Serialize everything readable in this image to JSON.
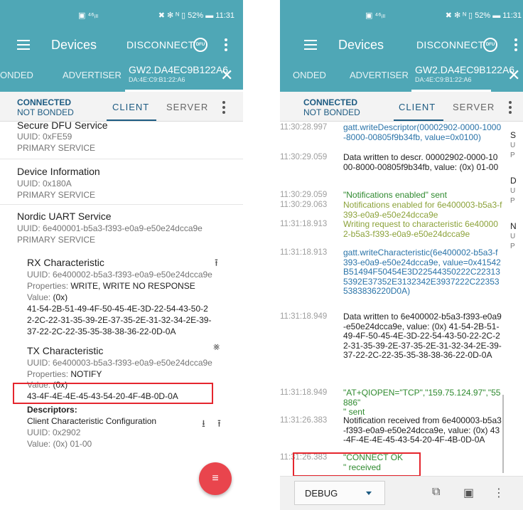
{
  "status": {
    "signal": "▣ ⁴⁶ᵢₗₗ",
    "indicators": "✖ ✻ ᴺ ▯ 52% ▬ 11:31",
    "right_indicators": "✖ ✻ ᴺ ▯ 52% ▬ 11:31"
  },
  "appbar": {
    "title": "Devices",
    "disconnect": "DISCONNECT",
    "dfu": "DFU"
  },
  "tabs": {
    "bonded": "ONDED",
    "advertiser": "ADVERTISER",
    "device_name": "GW2.DA4EC9B122A6",
    "device_addr": "DA:4E:C9:B1:22:A6",
    "close": "✕"
  },
  "conn": {
    "state": "CONNECTED",
    "bond": "NOT BONDED",
    "client": "CLIENT",
    "server": "SERVER"
  },
  "services": {
    "dfu": {
      "name": "Secure DFU Service",
      "uuid": "UUID: 0xFE59",
      "type": "PRIMARY SERVICE"
    },
    "devinfo": {
      "name": "Device Information",
      "uuid": "UUID: 0x180A",
      "type": "PRIMARY SERVICE"
    },
    "uart": {
      "name": "Nordic UART Service",
      "uuid": "UUID: 6e400001-b5a3-f393-e0a9-e50e24dcca9e",
      "type": "PRIMARY SERVICE"
    }
  },
  "rx": {
    "name": "RX Characteristic",
    "uuid": "UUID: 6e400002-b5a3-f393-e0a9-e50e24dcca9e",
    "props_label": "Properties: ",
    "props": "WRITE, WRITE NO RESPONSE",
    "value_label": "Value: ",
    "value_fmt": "(0x)",
    "value_l1": "41-54-2B-51-49-4F-50-45-4E-3D-22-54-43-50-2",
    "value_l2": "2-2C-22-31-35-39-2E-37-35-2E-31-32-34-2E-39-",
    "value_l3": "37-22-2C-22-35-35-38-38-36-22-0D-0A"
  },
  "tx": {
    "name": "TX Characteristic",
    "uuid": "UUID: 6e400003-b5a3-f393-e0a9-e50e24dcca9e",
    "props_label": "Properties: ",
    "props": "NOTIFY",
    "value_label": "Value: ",
    "value_fmt": "(0x)",
    "value_l1": "43-4F-4E-4E-45-43-54-20-4F-4B-0D-0A"
  },
  "descriptors": {
    "header": "Descriptors:",
    "name": "Client Characteristic Configuration",
    "uuid": "UUID: 0x2902",
    "value_label": "Value: ",
    "value": "(0x) 01-00"
  },
  "icons": {
    "upload": "⭱",
    "download": "⭳",
    "notify_off": "⨳",
    "fab": "≡"
  },
  "log": [
    {
      "ts": "11:30:28.997",
      "msg": "gatt.writeDescriptor(00002902-0000-1000-8000-00805f9b34fb, value=0x0100)",
      "color": "c-blue"
    },
    {
      "ts": "11:30:29.059",
      "msg": "Data written to descr. 00002902-0000-1000-8000-00805f9b34fb, value: (0x) 01-00",
      "color": "c-dark"
    },
    {
      "ts": "11:30:29.059",
      "msg": "\"Notifications enabled\" sent",
      "color": "c-green"
    },
    {
      "ts": "11:30:29.063",
      "msg": "Notifications enabled for 6e400003-b5a3-f393-e0a9-e50e24dcca9e",
      "color": "c-olive"
    },
    {
      "ts": "11:31:18.913",
      "msg": "Writing request to characteristic 6e400002-b5a3-f393-e0a9-e50e24dcca9e",
      "color": "c-olive"
    },
    {
      "ts": "11:31:18.913",
      "msg": "gatt.writeCharacteristic(6e400002-b5a3-f393-e0a9-e50e24dcca9e, value=0x41542B51494F50454E3D22544350222C223135392E37352E3132342E3937222C223535383836220D0A)",
      "color": "c-blue"
    },
    {
      "ts": "11:31:18.949",
      "msg": "Data written to 6e400002-b5a3-f393-e0a9-e50e24dcca9e, value: (0x) 41-54-2B-51-49-4F-50-45-4E-3D-22-54-43-50-22-2C-22-31-35-39-2E-37-35-2E-31-32-34-2E-39-37-22-2C-22-35-35-38-38-36-22-0D-0A",
      "color": "c-dark"
    },
    {
      "ts": "11:31:18.949",
      "msg": "\"AT+QIOPEN=\"TCP\",\"159.75.124.97\",\"55886\"\n\" sent",
      "color": "c-green"
    },
    {
      "ts": "11:31:26.383",
      "msg": "Notification received from 6e400003-b5a3-f393-e0a9-e50e24dcca9e, value: (0x) 43-4F-4E-4E-45-43-54-20-4F-4B-0D-0A",
      "color": "c-dark"
    },
    {
      "ts": "11:31:26.383",
      "msg": "\"CONNECT OK\n\" received",
      "color": "c-green"
    }
  ],
  "sidecut": [
    "S",
    "U",
    "P",
    "D",
    "U",
    "P",
    "N",
    "U",
    "P"
  ],
  "bottom": {
    "mode": "DEBUG",
    "copy_icon": "⧉",
    "save_icon": "▣",
    "more_icon": "⋮"
  },
  "colors": {
    "primary": "#4fa7b6",
    "accent_dark": "#1d5b82",
    "fab": "#e9454d",
    "highlight_box": "#e5262e"
  }
}
